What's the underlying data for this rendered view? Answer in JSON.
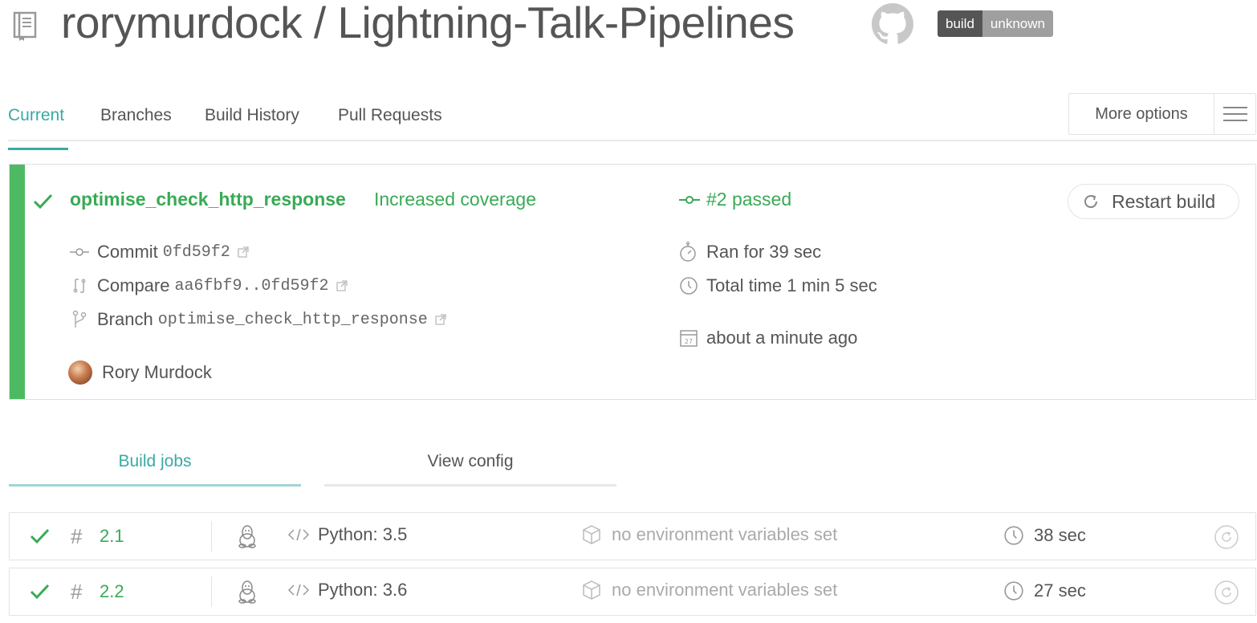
{
  "header": {
    "repo_title": "rorymurdock / Lightning-Talk-Pipelines",
    "badge_left": "build",
    "badge_right": "unknown"
  },
  "tabs": [
    "Current",
    "Branches",
    "Build History",
    "Pull Requests"
  ],
  "active_tab": "Current",
  "more_options": "More options",
  "build": {
    "branch": "optimise_check_http_response",
    "message": "Increased coverage",
    "state": "#2 passed",
    "restart_label": "Restart build",
    "commit_label": "Commit",
    "commit_sha": "0fd59f2",
    "compare_label": "Compare",
    "compare_range": "aa6fbf9..0fd59f2",
    "branch_label": "Branch",
    "branch_name": "optimise_check_http_response",
    "author": "Rory Murdock",
    "ran_for": "Ran for 39 sec",
    "total_time": "Total time 1 min 5 sec",
    "finished": "about a minute ago"
  },
  "subtabs": {
    "build_jobs": "Build jobs",
    "view_config": "View config"
  },
  "jobs": [
    {
      "number": "2.1",
      "language": "Python: 3.5",
      "env": "no environment variables set",
      "duration": "38 sec"
    },
    {
      "number": "2.2",
      "language": "Python: 3.6",
      "env": "no environment variables set",
      "duration": "27 sec"
    }
  ],
  "colors": {
    "passed": "#39aa56",
    "accent": "#39aaa4",
    "stripe": "#4dba63"
  }
}
